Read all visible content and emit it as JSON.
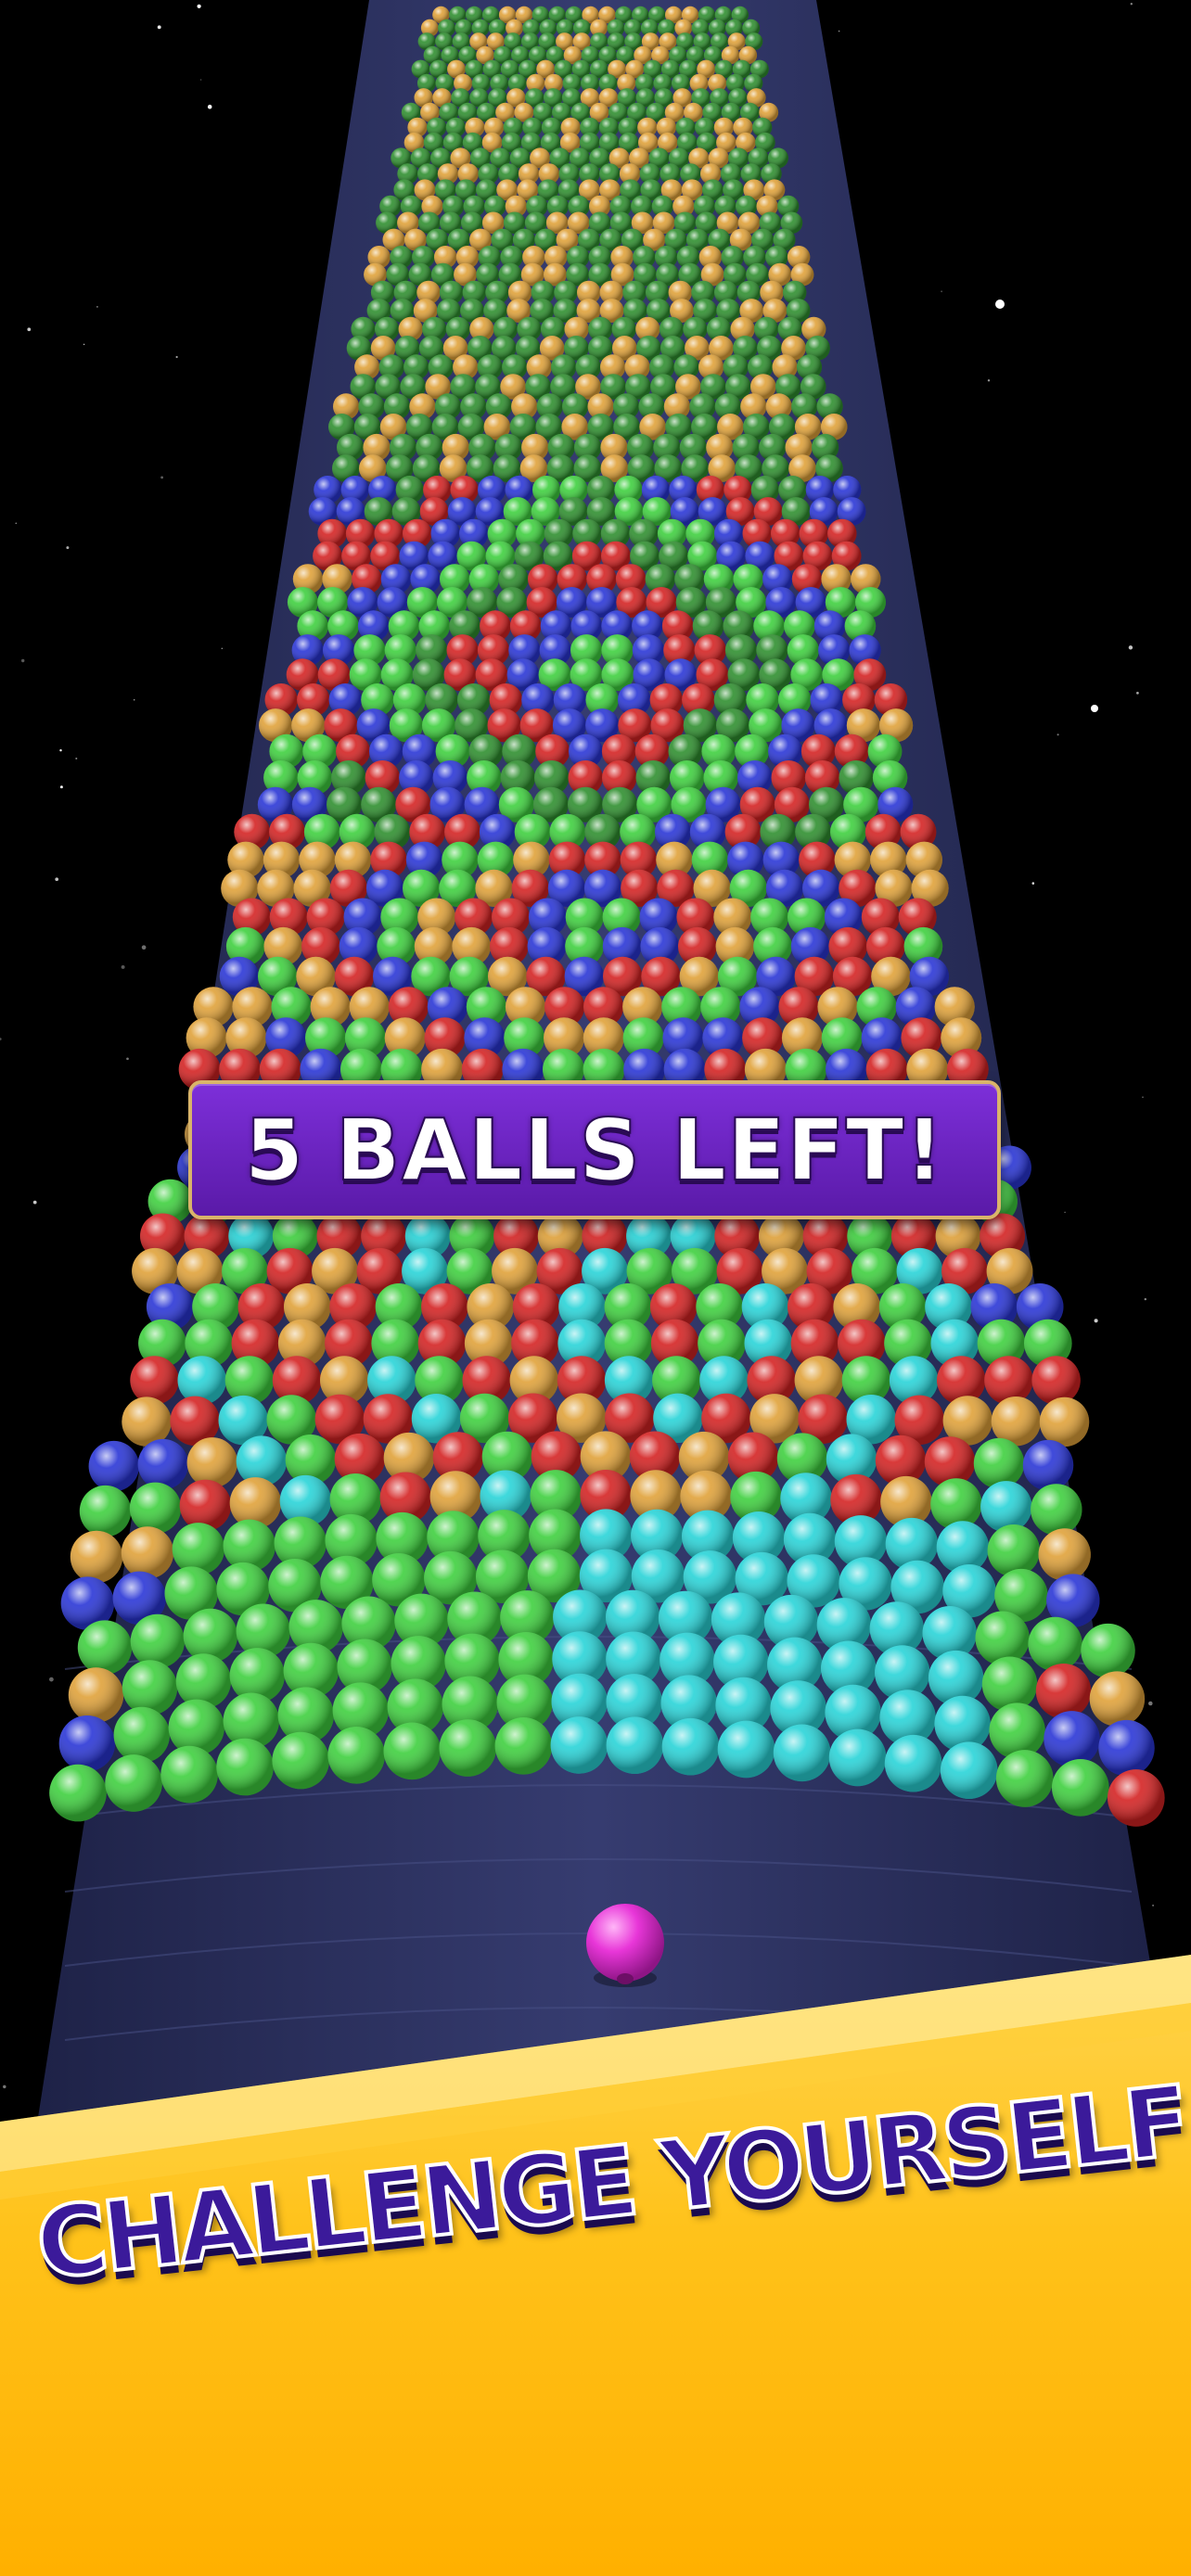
{
  "hud": {
    "balls_left_message": "5 BALLS LEFT!"
  },
  "promo": {
    "tagline": "CHALLENGE YOURSELF"
  },
  "player_ball": {
    "color": "#e836d8"
  },
  "colors": {
    "background": "#000000",
    "tower_base": "#2a2f5c",
    "banner_fill": "#6a22c0",
    "banner_border": "#d9b46a",
    "ribbon": "#ffc21a",
    "tagline_text": "#3b1a9a",
    "ball_palette": [
      "#2f8f2f",
      "#e0a23a",
      "#2a36d6",
      "#d42323",
      "#3fd03f",
      "#29d4d8"
    ]
  }
}
